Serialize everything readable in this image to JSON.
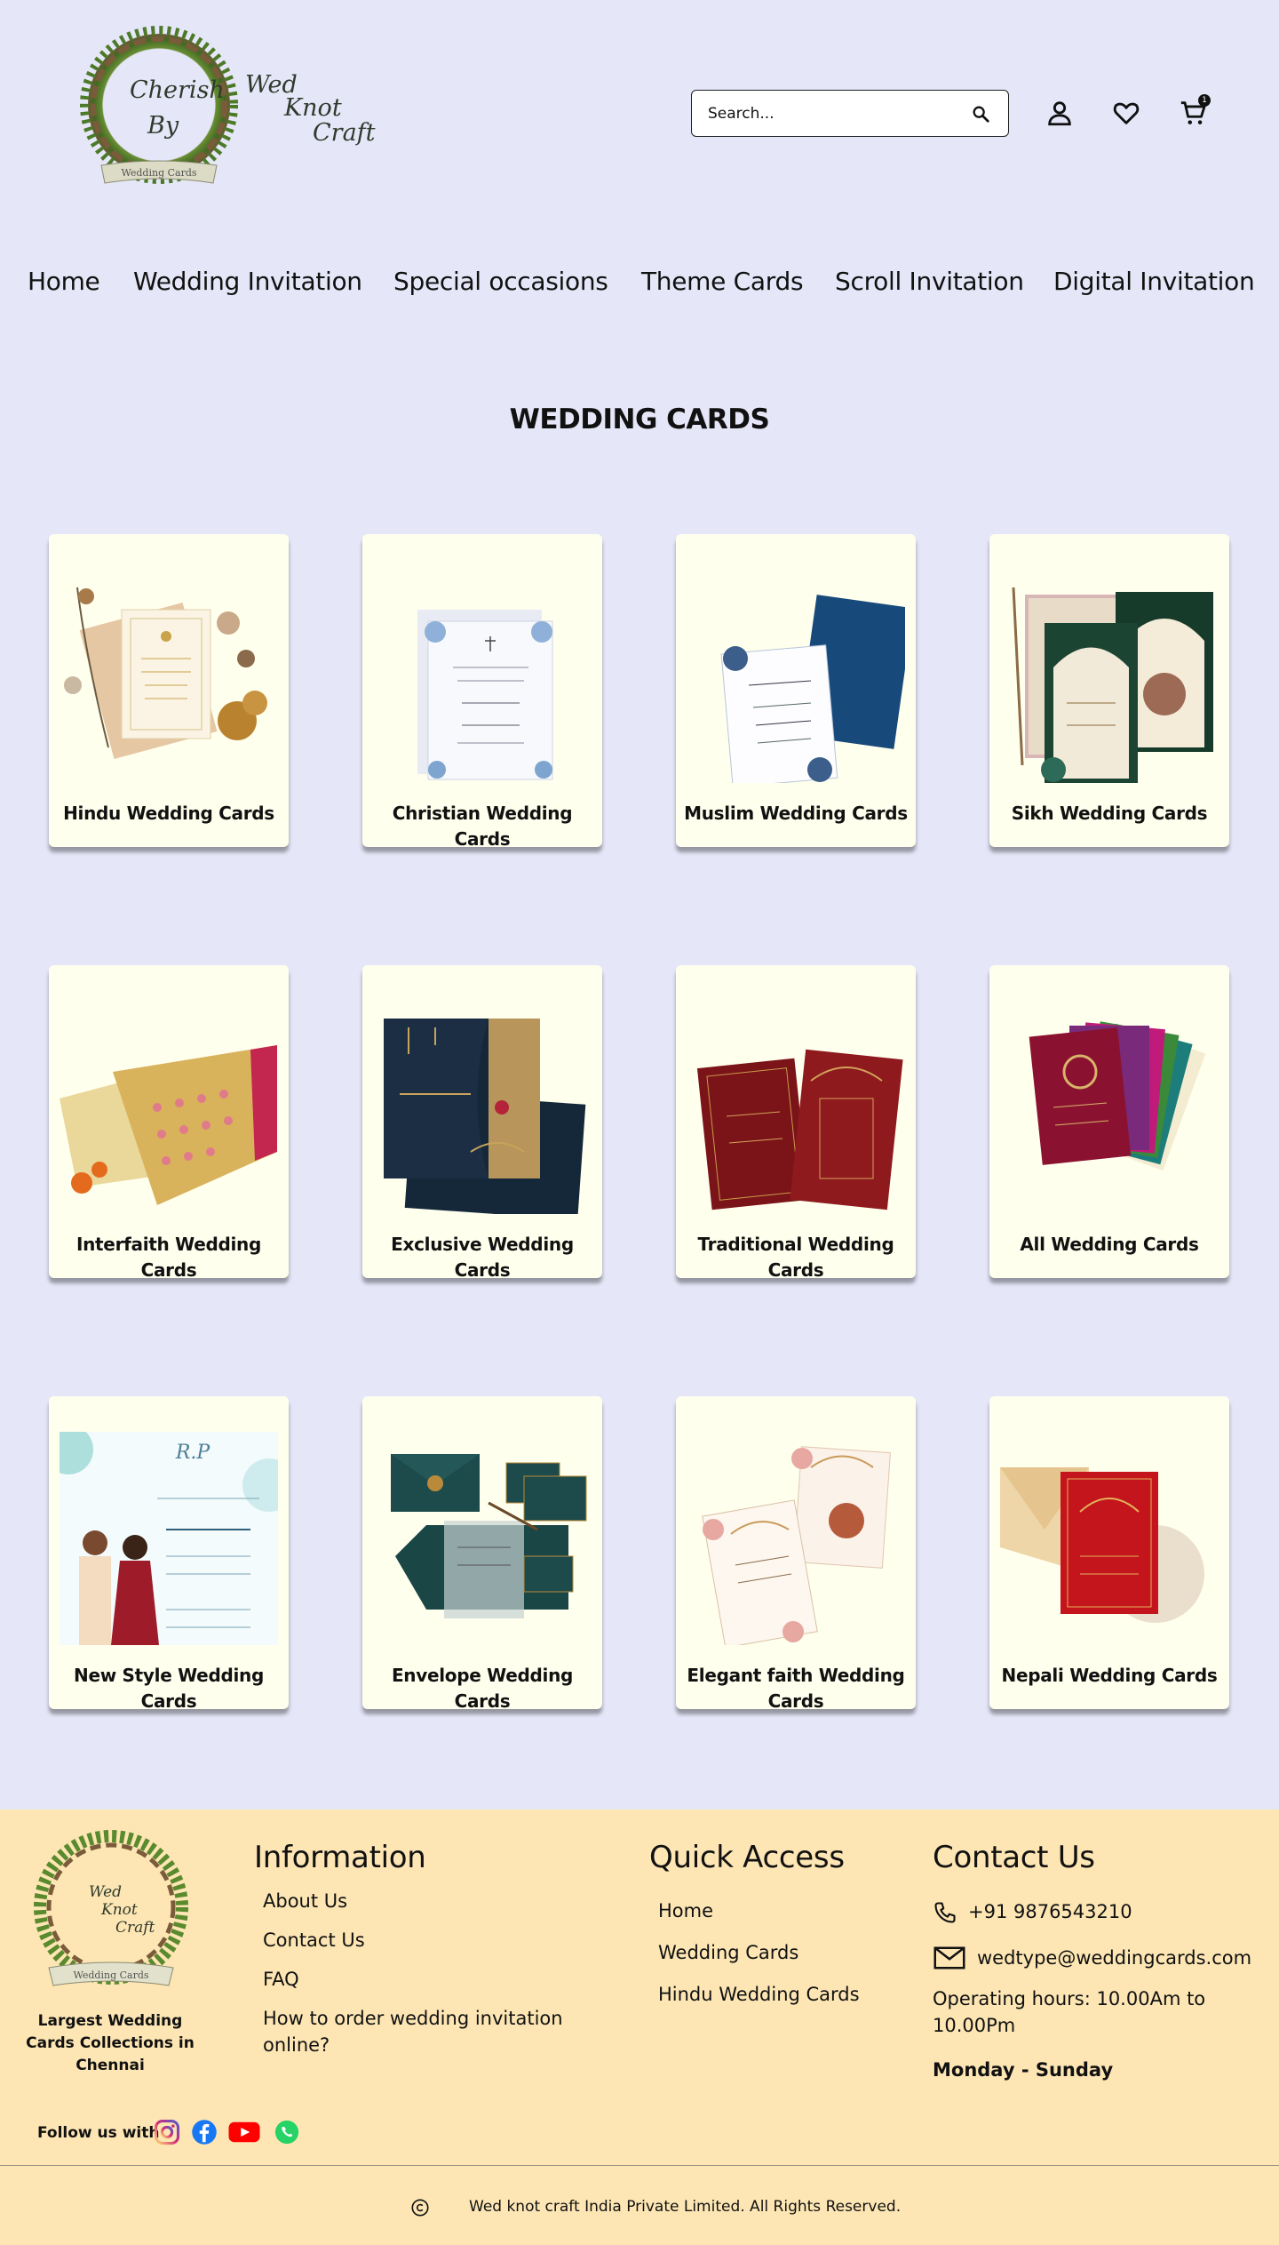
{
  "header": {
    "logo": {
      "words": [
        "Cherish",
        "By",
        "Wed",
        "Knot",
        "Craft"
      ],
      "ribbon": "Wedding Cards"
    },
    "search_placeholder": "Search...",
    "cart_count": "1"
  },
  "nav": {
    "items": [
      {
        "label": "Home"
      },
      {
        "label": "Wedding Invitation"
      },
      {
        "label": "Special occasions"
      },
      {
        "label": "Theme Cards"
      },
      {
        "label": "Scroll Invitation"
      },
      {
        "label": "Digital Invitation"
      }
    ]
  },
  "main": {
    "title": "WEDDING CARDS",
    "cards": [
      {
        "label": "Hindu Wedding Cards"
      },
      {
        "label": "Christian Wedding Cards"
      },
      {
        "label": "Muslim Wedding Cards"
      },
      {
        "label": "Sikh Wedding Cards"
      },
      {
        "label": "Interfaith Wedding Cards"
      },
      {
        "label": "Exclusive Wedding Cards"
      },
      {
        "label": "Traditional Wedding Cards"
      },
      {
        "label": "All Wedding Cards"
      },
      {
        "label": "New Style Wedding Cards"
      },
      {
        "label": "Envelope Wedding Cards"
      },
      {
        "label": "Elegant faith Wedding Cards"
      },
      {
        "label": "Nepali Wedding Cards"
      }
    ]
  },
  "footer": {
    "logo_words": [
      "Wed",
      "Knot",
      "Craft"
    ],
    "logo_ribbon": "Wedding Cards",
    "tagline": "Largest Wedding Cards Collections in Chennai",
    "information": {
      "heading": "Information",
      "links": [
        "About Us",
        "Contact Us",
        "FAQ",
        "How to order wedding invitation online?"
      ]
    },
    "quick_access": {
      "heading": "Quick Access",
      "links": [
        "Home",
        "Wedding Cards",
        "Hindu Wedding Cards"
      ]
    },
    "contact": {
      "heading": "Contact Us",
      "phone": "+91 9876543210",
      "email": "wedtype@weddingcards.com",
      "hours": "Operating hours: 10.00Am to 10.00Pm",
      "days": "Monday  - Sunday"
    },
    "follow_label": "Follow us with",
    "social": [
      "instagram-icon",
      "facebook-icon",
      "youtube-icon",
      "whatsapp-icon"
    ],
    "copyright": "Wed knot craft India Private Limited. All Rights Reserved."
  },
  "colors": {
    "page_bg": "#e5e7f8",
    "card_bg": "#ffffee",
    "footer_bg": "#fde6b4"
  }
}
